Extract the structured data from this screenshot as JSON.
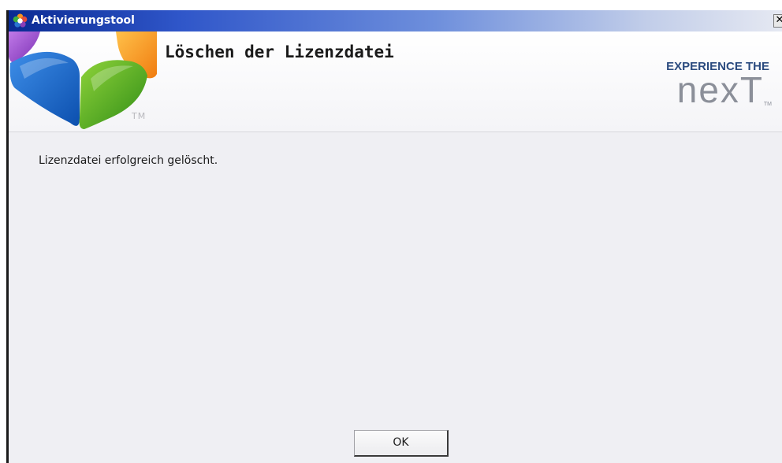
{
  "window": {
    "title": "Aktivierungstool",
    "close_glyph": "✕"
  },
  "header": {
    "title": "Löschen der Lizenzdatei",
    "logo_tm": "TM",
    "brand_line1": "EXPERIENCE THE",
    "brand_word": "nexT",
    "brand_tm": "TM"
  },
  "content": {
    "message": "Lizenzdatei erfolgreich gelöscht."
  },
  "buttons": {
    "ok_label": "OK"
  },
  "colors": {
    "title_bar": "#0a2a92",
    "brand_blue": "#2b4b7f",
    "brand_gray": "#8b8f99",
    "window_bg": "#efeff3"
  },
  "icons": {
    "title_icon": "app-flower-icon",
    "logo": "product-logo"
  }
}
